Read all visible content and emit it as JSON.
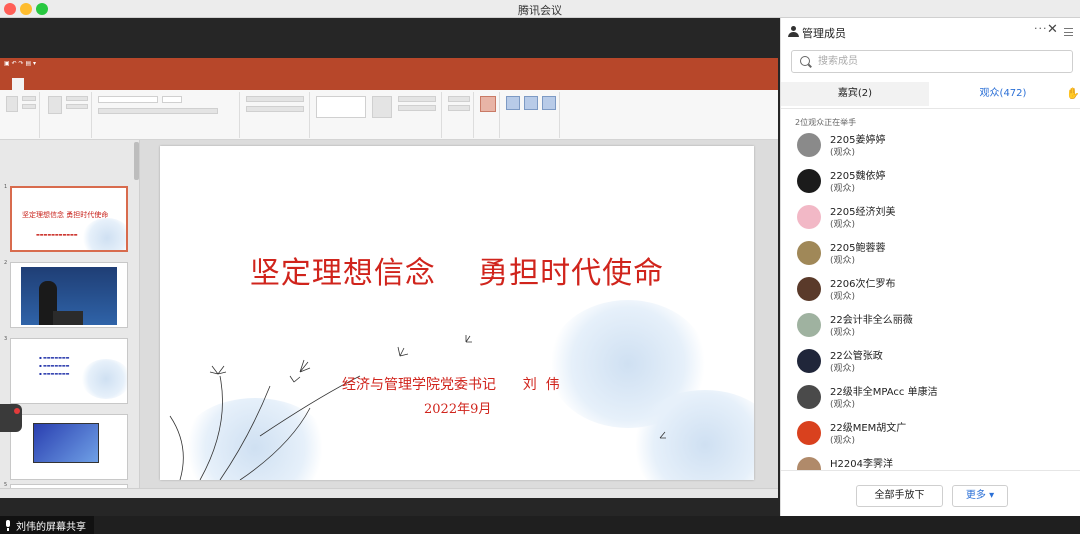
{
  "window": {
    "title": "腾讯会议"
  },
  "share": {
    "sharer_label": "刘伟的屏幕共享",
    "slide": {
      "title": "坚定理想信念    勇担时代使命",
      "subtitle": "经济与管理学院党委书记      刘  伟",
      "date": "2022年9月"
    },
    "thumbs": [
      "1",
      "2",
      "3",
      "4",
      "5"
    ]
  },
  "panel": {
    "title": "管理成员",
    "search_placeholder": "搜索成员",
    "tabs": {
      "guests": "嘉宾(2)",
      "audience": "观众(472)"
    },
    "hand_status": "2位观众正在举手",
    "members": [
      {
        "name": "2205姜婷婷",
        "role": "(观众)",
        "avatar": "#8a8a8a"
      },
      {
        "name": "2205魏依婷",
        "role": "(观众)",
        "avatar": "#1b1b1b"
      },
      {
        "name": "2205经济刘美",
        "role": "(观众)",
        "avatar": "#f2b8c6"
      },
      {
        "name": "2205鲍蓉蓉",
        "role": "(观众)",
        "avatar": "#a08858"
      },
      {
        "name": "2206次仁罗布",
        "role": "(观众)",
        "avatar": "#5a3a2a"
      },
      {
        "name": "22会计非全么丽薇",
        "role": "(观众)",
        "avatar": "#9fb2a0"
      },
      {
        "name": "22公管张政",
        "role": "(观众)",
        "avatar": "#20263a"
      },
      {
        "name": "22级非全MPAcc  单康洁",
        "role": "(观众)",
        "avatar": "#4a4a4a"
      },
      {
        "name": "22级MEM胡文广",
        "role": "(观众)",
        "avatar": "#d9411e"
      },
      {
        "name": "H2204李霁洋",
        "role": "(观众)",
        "avatar": "#b08a6a"
      }
    ],
    "footer": {
      "lower_all": "全部手放下",
      "more": "更多 ▾"
    }
  },
  "colors": {
    "ppt_accent": "#b7472a",
    "slide_red": "#d0241c",
    "link_blue": "#2a6fd6"
  }
}
